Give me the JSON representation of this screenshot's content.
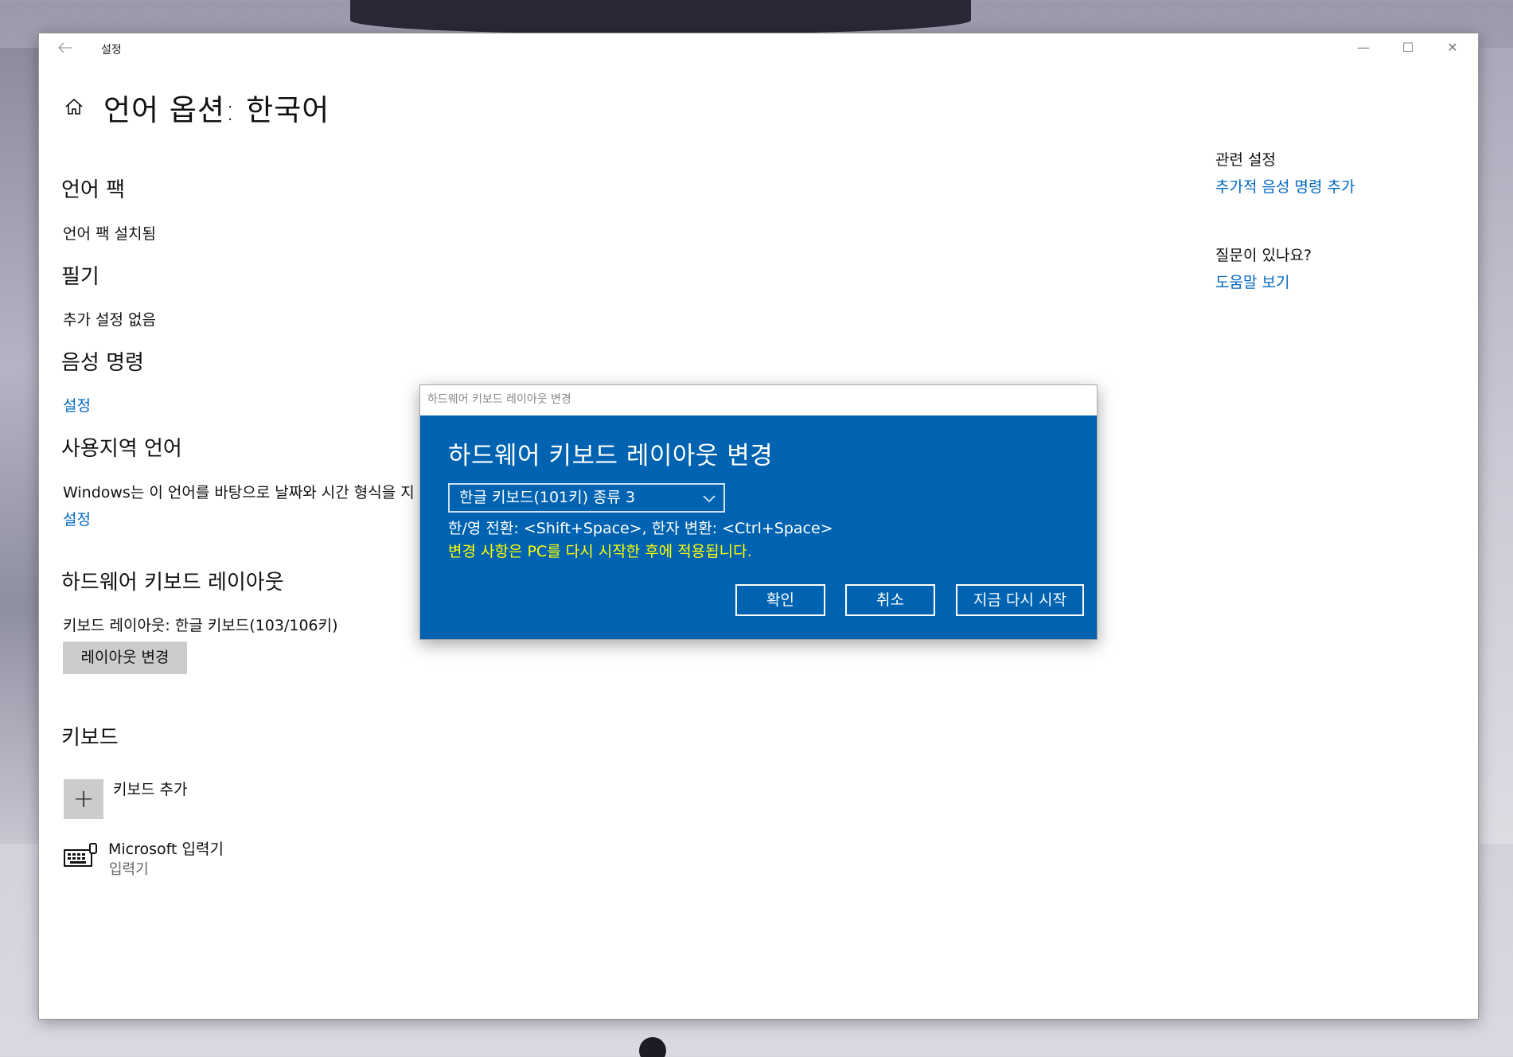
{
  "window": {
    "app_title": "설정",
    "back_icon": "arrow-left-icon",
    "min_glyph": "—",
    "max_glyph": "☐",
    "close_glyph": "✕"
  },
  "page": {
    "title": "언어 옵션: 한국어"
  },
  "sections": {
    "language_pack": {
      "heading": "언어 팩",
      "text": "언어 팩 설치됨"
    },
    "handwriting": {
      "heading": "필기",
      "text": "추가 설정 없음"
    },
    "speech": {
      "heading": "음성 명령",
      "link": "설정"
    },
    "regional": {
      "heading": "사용지역 언어",
      "text": "Windows는 이 언어를 바탕으로 날짜와 시간 형식을 지",
      "link": "설정"
    },
    "hardware_keyboard": {
      "heading": "하드웨어 키보드 레이아웃",
      "text": "키보드 레이아웃: 한글 키보드(103/106키)",
      "button": "레이아웃 변경"
    },
    "keyboards": {
      "heading": "키보드",
      "add_label": "키보드 추가",
      "add_glyph": "+",
      "ime_name": "Microsoft 입력기",
      "ime_sub": "입력기"
    }
  },
  "sidebar": {
    "related_heading": "관련 설정",
    "related_link": "추가적 음성 명령 추가",
    "question_heading": "질문이 있나요?",
    "help_link": "도움말 보기"
  },
  "dialog": {
    "window_title": "하드웨어 키보드 레이아웃 변경",
    "heading": "하드웨어 키보드 레이아웃 변경",
    "selected_layout": "한글 키보드(101키) 종류 3",
    "info": "한/영 전환: <Shift+Space>, 한자 변환: <Ctrl+Space>",
    "warning": "변경 사항은 PC를 다시 시작한 후에 적용됩니다.",
    "ok": "확인",
    "cancel": "취소",
    "restart": "지금 다시 시작"
  },
  "colors": {
    "accent_link": "#0067c0",
    "dialog_bg": "#0063b1",
    "warning_text": "#ffff00",
    "button_gray": "#cccccc"
  }
}
